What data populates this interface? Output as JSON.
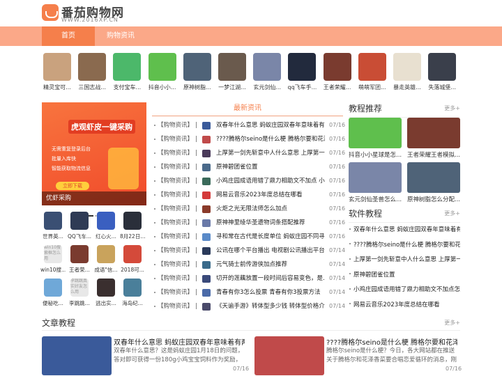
{
  "header": {
    "logo_title": "番茄购物网",
    "logo_sub": "WWW.2016XP.CN"
  },
  "nav": {
    "home": "首页",
    "news": "购物资讯"
  },
  "top_apps": [
    {
      "label": "精灵宝可...",
      "color": "#c9a27e"
    },
    {
      "label": "三国志战...",
      "color": "#8a6a4f"
    },
    {
      "label": "支付宝车...",
      "color": "#4cb86a"
    },
    {
      "label": "抖音小小...",
      "color": "#5fbf4d"
    },
    {
      "label": "原神树脂...",
      "color": "#4f6378"
    },
    {
      "label": "一梦江湖...",
      "color": "#6a5a4d"
    },
    {
      "label": "玄元剑仙...",
      "color": "#7a86a8"
    },
    {
      "label": "qq飞车手...",
      "color": "#222a3d"
    },
    {
      "label": "王者荣耀...",
      "color": "#7a3b2f"
    },
    {
      "label": "萌萌军团...",
      "color": "#c94d35"
    },
    {
      "label": "暴走英雄...",
      "color": "#e8e0d0"
    },
    {
      "label": "失落城堡...",
      "color": "#3a3f4b"
    }
  ],
  "banner": {
    "title": "虎观虾皮一键采购",
    "lines": [
      "无需重复登录后台",
      "批量入库快",
      "智能获取物流信息"
    ],
    "button": "立即下载",
    "caption": "优虾采购"
  },
  "grid_apps": [
    {
      "label": "世界英...",
      "color": "#3a4f73"
    },
    {
      "label": "QQ飞车...",
      "color": "#2f3b55"
    },
    {
      "label": "红心火...",
      "color": "#3a5fc0"
    },
    {
      "label": "8月22日...",
      "color": "#2a2f3a"
    },
    {
      "label": "win10搜...",
      "color": "#e8e8e8",
      "alt": "win10搜索框怎么用"
    },
    {
      "label": "王者荣...",
      "color": "#7a3b2f"
    },
    {
      "label": "成语\"信...",
      "color": "#c9a35c"
    },
    {
      "label": "2018可...",
      "color": "#d44a3a"
    },
    {
      "label": "便秘吃...",
      "color": "#6fa8d8"
    },
    {
      "label": "李跳跳...",
      "color": "#e8e8e8",
      "alt": "李跳跳真实好友怎么用"
    },
    {
      "label": "逃出实...",
      "color": "#3a2f2f"
    },
    {
      "label": "海岛纪...",
      "color": "#4a7f9a"
    }
  ],
  "news": {
    "heading": "最新资讯",
    "cat": "【购物资讯】",
    "sep": "|",
    "rows": [
      {
        "title": "双春年什么意思 蚂蚁庄园双春年意味着有两...",
        "date": "07/16",
        "color": "#3a5a9a"
      },
      {
        "title": "????腾格尔seino是什么梗 腾格尔要和花泽...",
        "date": "07/16",
        "color": "#c04a4a"
      },
      {
        "title": "上厚第一剑先斩意中人什么意思 上厚第一...",
        "date": "07/16",
        "color": "#4a3a5a"
      },
      {
        "title": "原神碧团雀位置",
        "date": "07/16",
        "color": "#4a6a8a"
      },
      {
        "title": "小鸡庄园成语用错了鼎力相助文不加点 小...",
        "date": "07/16",
        "color": "#3a6a5a"
      },
      {
        "title": "网易云音乐2023年度总结在哪看",
        "date": "07/16",
        "color": "#d43a3a"
      },
      {
        "title": "火炬之光无限法师怎么加点",
        "date": "07/16",
        "color": "#8a3a2a"
      },
      {
        "title": "原神神里绫华圣遗物词条搭配推荐",
        "date": "07/16",
        "color": "#6a7aa8"
      },
      {
        "title": "寻和常在古代是长度单位 蚂蚁庄园不同寻...",
        "date": "07/16",
        "color": "#5a8ac8"
      },
      {
        "title": "公讯在哪个平台播出 电视剧公讯播出平台...",
        "date": "07/14",
        "color": "#2a3a5a"
      },
      {
        "title": "元气骑士前传游侠加点推荐",
        "date": "07/14",
        "color": "#3a6a8a"
      },
      {
        "title": "切开的莲藕放置一段时间后容易变色，是...",
        "date": "07/14",
        "color": "#3a4a7a"
      },
      {
        "title": "青春有你3怎么投票 青春有你3投票方法",
        "date": "07/14",
        "color": "#4a6aa8"
      },
      {
        "title": "《天谕手游》转体型多少钱 转体型价格介绍",
        "date": "07/14",
        "color": "#4a4a6a"
      }
    ]
  },
  "tutorials": {
    "title": "教程推荐",
    "more": "更多+",
    "items": [
      {
        "label": "抖音小小星球是怎...",
        "color": "#5fbf4d"
      },
      {
        "label": "王者荣耀王者模拟...",
        "color": "#7a3b2f"
      },
      {
        "label": "玄元剑仙圣兽怎么...",
        "color": "#7a86a8"
      },
      {
        "label": "原神树脂怎么分配...",
        "color": "#4f6378"
      }
    ]
  },
  "software": {
    "title": "软件教程",
    "more": "更多+",
    "items": [
      "双春年什么意思 蚂蚁庄园双春年意味着有...",
      "????腾格尔seino是什么梗 腾格尔要和花泽香...",
      "上厚第一剑先斩意中人什么意思 上厚第一...",
      "原神碧团雀位置",
      "小鸡庄园成语用错了鼎力相助文不加点怎么...",
      "网易云音乐2023年度总结在哪看"
    ]
  },
  "articles": {
    "title": "文章教程",
    "more": "更多+",
    "items": [
      {
        "title": "双春年什么意思 蚂蚁庄园双春年意味着有两...",
        "desc": "双春年什么意思？这是蚂蚁庄园1月18日的问题，答对即可获得一份180g小鸡宝宝饲料作为奖励，那么接...",
        "date": "07/16",
        "color": "#3a5a9a"
      },
      {
        "title": "????腾格尔seino是什么梗 腾格尔要和花泽香...",
        "desc": "腾格尔seino是什么梗？今日，各大网站都在推送关于腾格尔和花泽香菜要合唱恋爱循环的消息，刚刚腾...",
        "date": "07/16",
        "color": "#c04a4a"
      }
    ]
  }
}
